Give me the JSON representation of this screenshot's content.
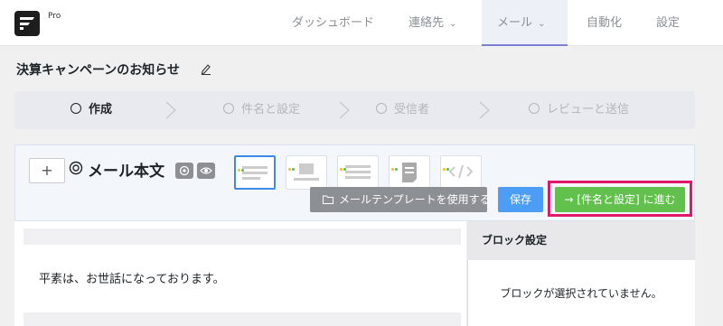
{
  "app": {
    "plan_label": "Pro"
  },
  "nav": {
    "items": [
      {
        "label": "ダッシュボード",
        "has_dropdown": false,
        "active": false
      },
      {
        "label": "連絡先",
        "has_dropdown": true,
        "active": false
      },
      {
        "label": "メール",
        "has_dropdown": true,
        "active": true
      },
      {
        "label": "自動化",
        "has_dropdown": false,
        "active": false
      },
      {
        "label": "設定",
        "has_dropdown": false,
        "active": false
      }
    ]
  },
  "page": {
    "title": "決算キャンペーンのお知らせ"
  },
  "steps": [
    {
      "label": "作成",
      "active": true
    },
    {
      "label": "件名と設定",
      "active": false
    },
    {
      "label": "受信者",
      "active": false
    },
    {
      "label": "レビューと送信",
      "active": false
    }
  ],
  "editor": {
    "add_label": "+",
    "body_title": "メール本文",
    "template_button": "メールテンプレートを使用する",
    "save_button": "保存",
    "next_button": "→ [件名と設定] に進む",
    "content_text": "平素は、お世話になっております。"
  },
  "block_panel": {
    "title": "ブロック設定",
    "empty_text": "ブロックが選択されていません。"
  },
  "colors": {
    "accent": "#7b7fd6",
    "save": "#4b9df6",
    "next": "#62c14d",
    "highlight": "#e0186c",
    "template_button": "#8c8f94"
  }
}
